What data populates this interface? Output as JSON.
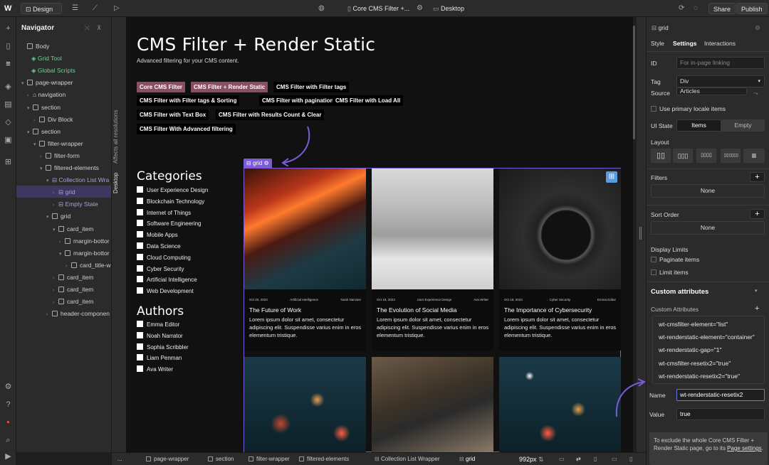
{
  "topbar": {
    "mode": "Design",
    "page_name": "Core CMS Filter +...",
    "breakpoint": "Desktop",
    "share": "Share",
    "publish": "Publish"
  },
  "navigator": {
    "title": "Navigator",
    "items": [
      {
        "label": "Body"
      },
      {
        "label": "Grid Tool"
      },
      {
        "label": "Global Scripts"
      },
      {
        "label": "page-wrapper"
      },
      {
        "label": "navigation"
      },
      {
        "label": "section"
      },
      {
        "label": "Div Block"
      },
      {
        "label": "section"
      },
      {
        "label": "filter-wrapper"
      },
      {
        "label": "filter-form"
      },
      {
        "label": "filtered-elements"
      },
      {
        "label": "Collection List Wra"
      },
      {
        "label": "grid"
      },
      {
        "label": "Empty State"
      },
      {
        "label": "grid"
      },
      {
        "label": "card_item"
      },
      {
        "label": "margin-bottor"
      },
      {
        "label": "margin-bottor"
      },
      {
        "label": "card_title-w"
      },
      {
        "label": "card_item"
      },
      {
        "label": "card_item"
      },
      {
        "label": "card_item"
      },
      {
        "label": "header-componen"
      }
    ]
  },
  "canvas": {
    "affects_label": "Affects all resolutions",
    "desktop_label": "Desktop",
    "heading": "CMS Filter + Render Static",
    "subheading": "Advanced filtering for your CMS content.",
    "tags": [
      "Core CMS Filter",
      "CMS Filter + Render Static",
      "CMS Filter with Filter tags",
      "CMS Filter with Filter tags & Sorting",
      "CMS Filter with pagination",
      "CMS Filter with Load All",
      "CMS Filter with Text Box",
      "CMS Filter with Results Count & Clear",
      "CMS Filter With Advanced filtering"
    ],
    "categories_title": "Categories",
    "categories": [
      "User Experience Design",
      "Blockchain Technology",
      "Internet of Things",
      "Software Engineering",
      "Mobile Apps",
      "Data Science",
      "Cloud Computing",
      "Cyber Security",
      "Artificial Intelligence",
      "Web Development"
    ],
    "authors_title": "Authors",
    "authors": [
      "Emma Editor",
      "Noah Narrator",
      "Sophia Scribbler",
      "Liam Penman",
      "Ava Writer"
    ],
    "grid_label": "grid",
    "cards": [
      {
        "date": "Oct 20, 2023",
        "category": "Artificial Intelligence",
        "author": "Noah Narrator",
        "title": "The Future of Work",
        "body": "Lorem ipsum dolor sit amet, consectetur adipiscing elit. Suspendisse varius enim in eros elementum tristique."
      },
      {
        "date": "Oct 19, 2023",
        "category": "User Experience Design",
        "author": "Ava Writer",
        "title": "The Evolution of Social Media",
        "body": "Lorem ipsum dolor sit amet, consectetur adipiscing elit. Suspendisse varius enim in eros elementum tristique."
      },
      {
        "date": "Oct 18, 2023",
        "category": "Cyber Security",
        "author": "Emma Editor",
        "title": "The Importance of Cybersecurity",
        "body": "Lorem ipsum dolor sit amet, consectetur adipiscing elit. Suspendisse varius enim in eros elementum tristique."
      }
    ]
  },
  "panel": {
    "element": "grid",
    "tabs": [
      "Style",
      "Settings",
      "Interactions"
    ],
    "id_label": "ID",
    "id_placeholder": "For in-page linking",
    "tag_label": "Tag",
    "tag_value": "Div",
    "source_label": "Source",
    "source_value": "Articles",
    "primary_locale": "Use primary locale items",
    "ui_state_label": "UI State",
    "ui_state_items": "Items",
    "ui_state_empty": "Empty",
    "layout_label": "Layout",
    "filters_label": "Filters",
    "filters_value": "None",
    "sort_label": "Sort Order",
    "sort_value": "None",
    "display_limits": "Display Limits",
    "paginate": "Paginate items",
    "limit": "Limit items",
    "custom_attributes_title": "Custom attributes",
    "custom_attributes_sub": "Custom Attributes",
    "attributes": [
      "wt-cmsfilter-element=\"list\"",
      "wt-renderstatic-element=\"container\"",
      "wt-renderstatic-gap=\"1\"",
      "wt-cmsfilter-resetix2=\"true\"",
      "wt-renderstatic-resetix2=\"true\""
    ],
    "name_label": "Name",
    "name_value": "wt-renderstatic-resetix2",
    "value_label": "Value",
    "value_value": "true",
    "note": "To exclude the whole Core CMS Filter + Render Static page, go to its ",
    "note_link": "Page settings",
    "note_end": "."
  },
  "breadcrumbs": [
    "...",
    "page-wrapper",
    "section",
    "filter-wrapper",
    "filtered-elements",
    "Collection List Wrapper",
    "grid"
  ],
  "width_readout": "992px"
}
